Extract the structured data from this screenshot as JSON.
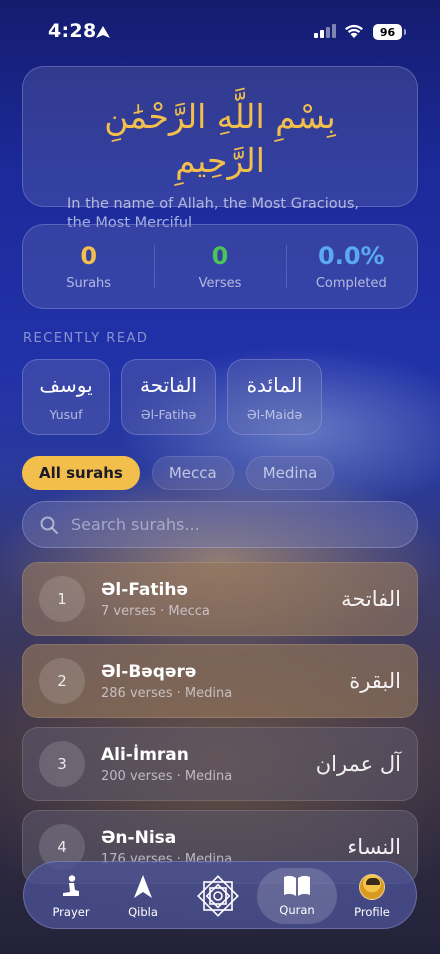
{
  "status_bar": {
    "time": "4:28",
    "battery": "96"
  },
  "bismillah": {
    "arabic": "بِسْمِ اللَّهِ الرَّحْمَٰنِ الرَّحِيمِ",
    "translation": "In the name of Allah, the Most Gracious, the Most Merciful"
  },
  "stats": [
    {
      "value": "0",
      "label": "Surahs",
      "color": "#f2bf4c"
    },
    {
      "value": "0",
      "label": "Verses",
      "color": "#4cc45a"
    },
    {
      "value": "0.0%",
      "label": "Completed",
      "color": "#5aaaf2"
    }
  ],
  "recent": {
    "title": "RECENTLY READ",
    "items": [
      {
        "arabic": "يوسف",
        "latin": "Yusuf"
      },
      {
        "arabic": "الفاتحة",
        "latin": "Əl-Fatihə"
      },
      {
        "arabic": "المائدة",
        "latin": "Əl-Maidə"
      }
    ]
  },
  "filters": {
    "all": "All surahs",
    "mecca": "Mecca",
    "medina": "Medina"
  },
  "search": {
    "placeholder": "Search surahs..."
  },
  "surahs": [
    {
      "number": "1",
      "name": "Əl-Fatihə",
      "meta": "7 verses · Mecca",
      "arabic": "الفاتحة"
    },
    {
      "number": "2",
      "name": "Əl-Bəqərə",
      "meta": "286 verses · Medina",
      "arabic": "البقرة"
    },
    {
      "number": "3",
      "name": "Ali-İmran",
      "meta": "200 verses · Medina",
      "arabic": "آل عمران"
    },
    {
      "number": "4",
      "name": "Ən-Nisa",
      "meta": "176 verses · Medina",
      "arabic": "النساء"
    }
  ],
  "tabs": {
    "prayer": "Prayer",
    "qibla": "Qibla",
    "quran": "Quran",
    "profile": "Profile"
  },
  "accent_color": "#f2bf4c"
}
